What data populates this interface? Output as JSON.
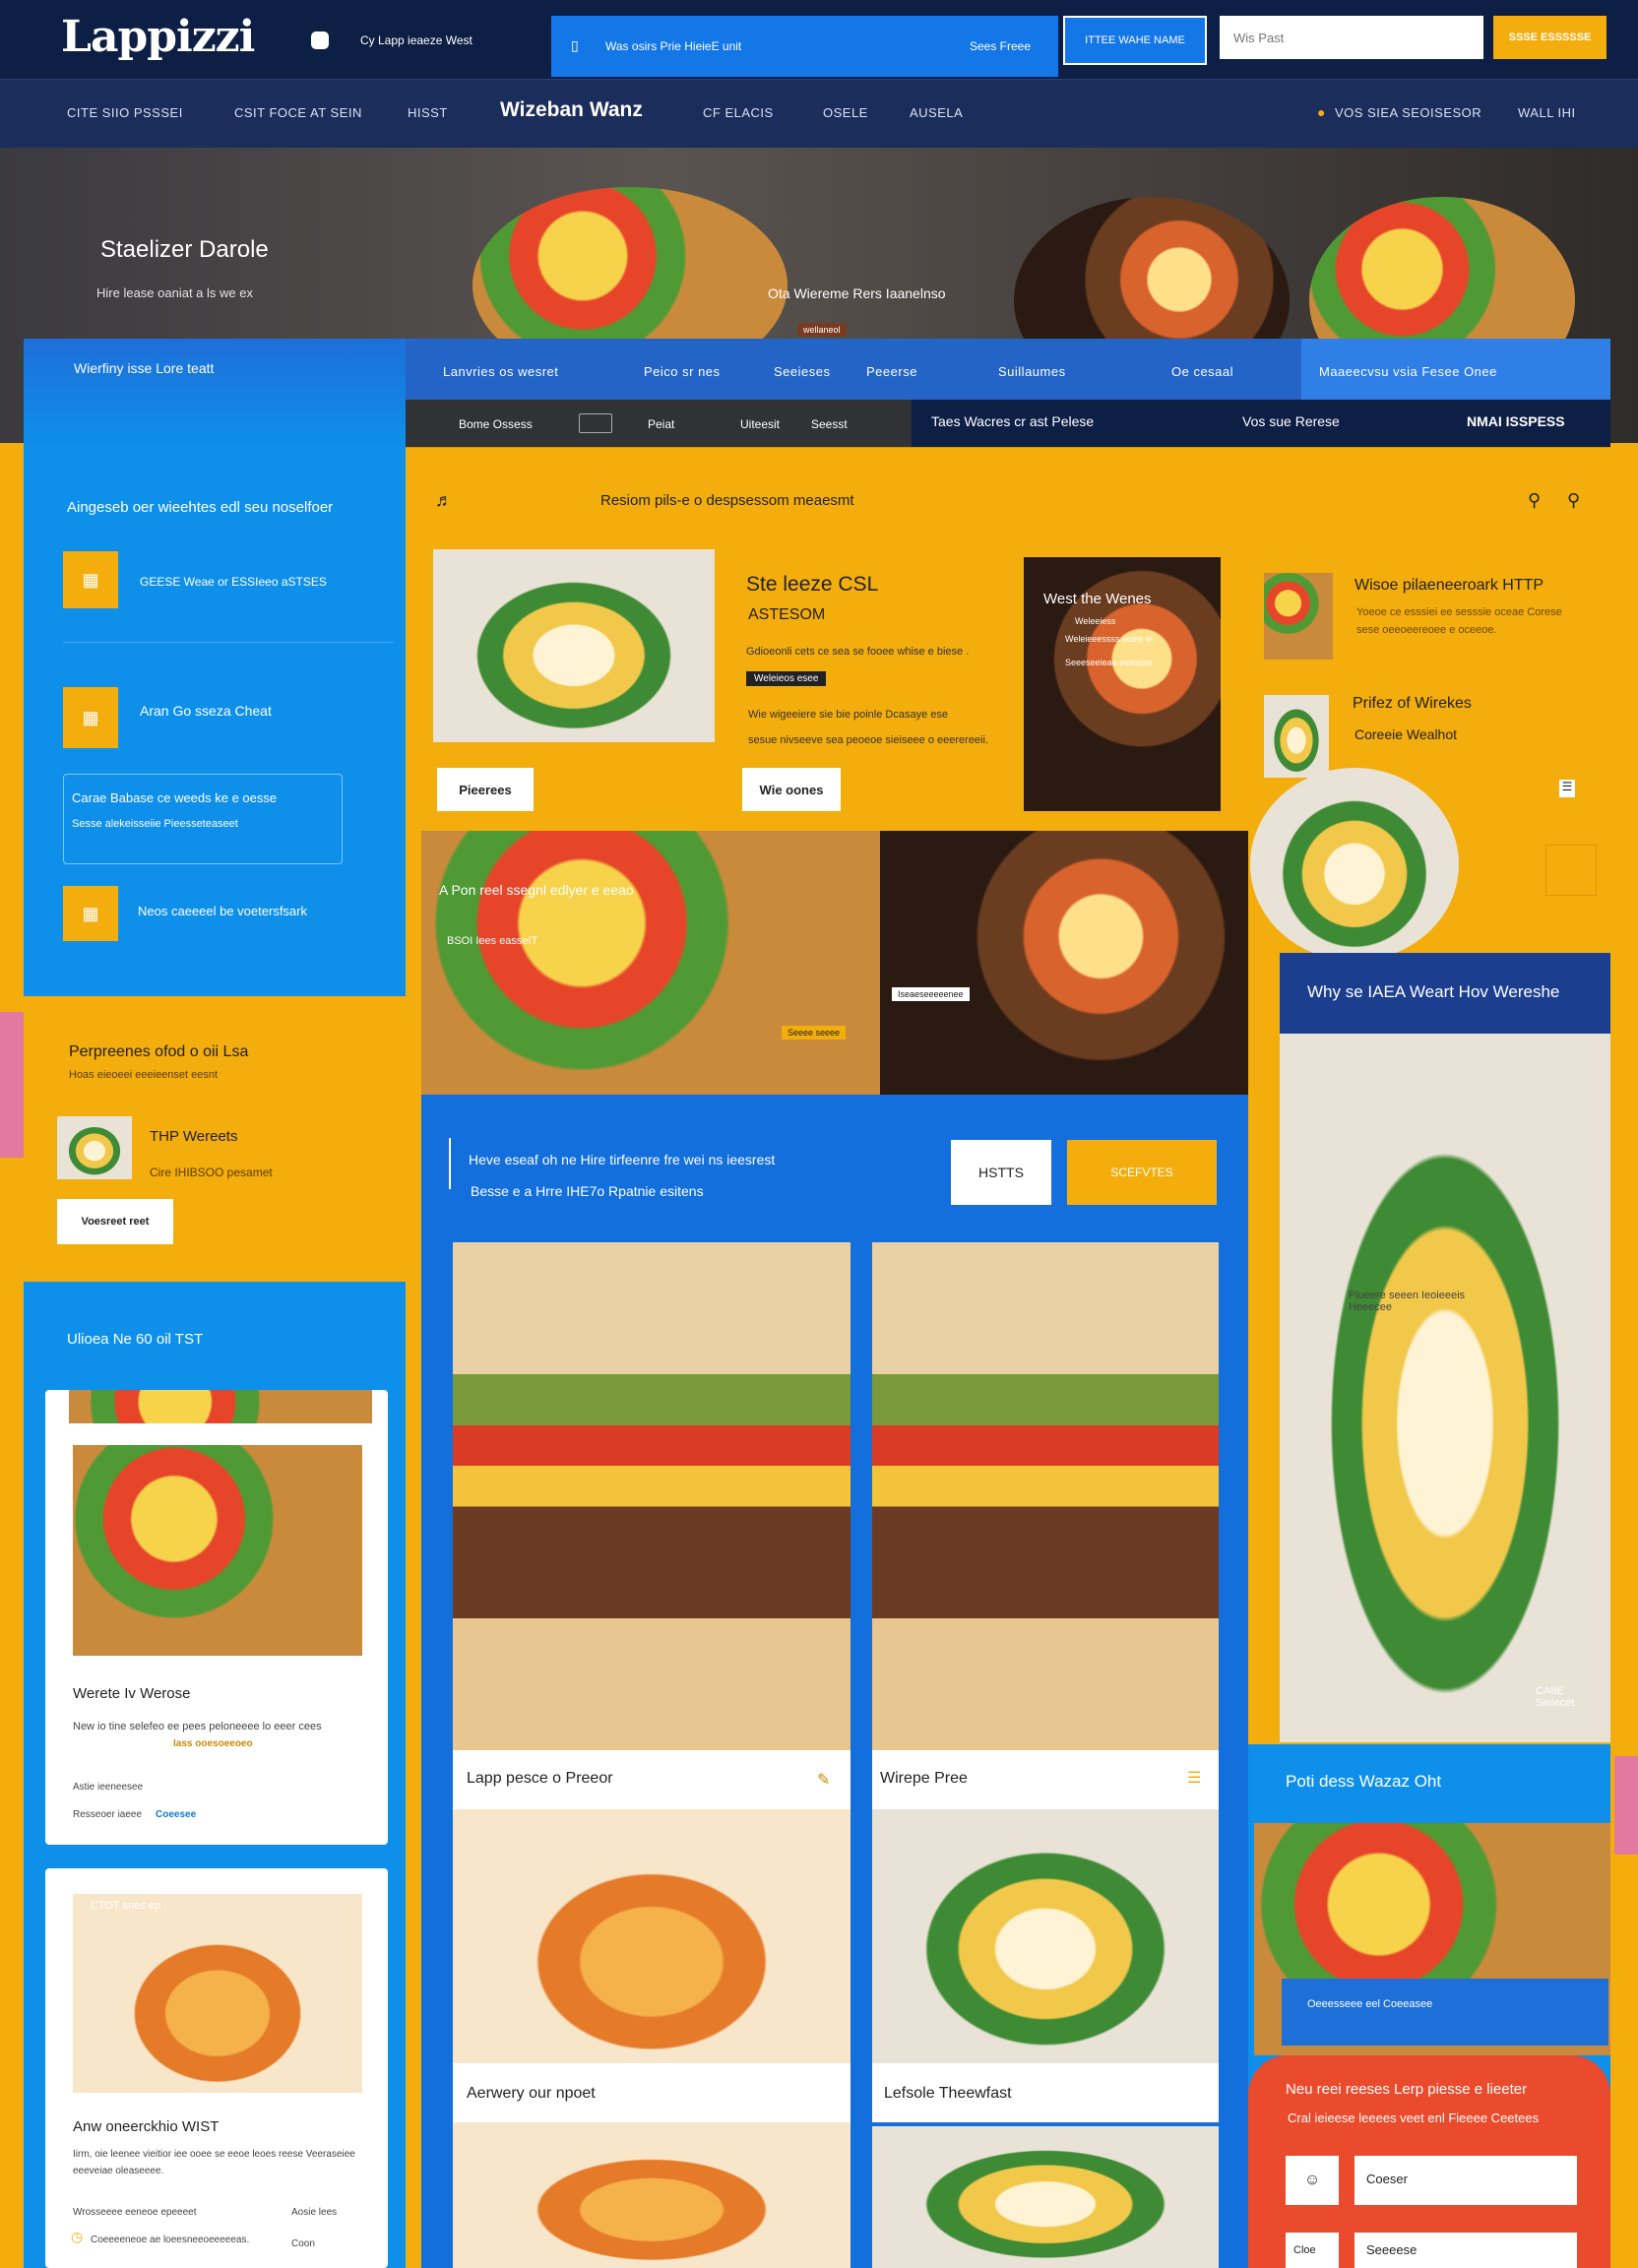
{
  "brand": {
    "logo": "Lappizzi",
    "logo_tag": "Cy Lapp ieaeze West"
  },
  "topbar": {
    "promo_left": "Was osirs Prie HieieE unit",
    "promo_right": "Sees Freee",
    "btn_outline": "ITTEE WAHE NAME",
    "search_placeholder": "Wis Past",
    "btn_yellow": "SSSE ESSSSSE"
  },
  "nav": {
    "links": [
      "CITE SIIO PSSSEI",
      "CSIT FOCE AT SEIN",
      "HISST",
      "CF ELACIS",
      "OSELE",
      "AUSELA"
    ],
    "center": "Wizeban Wanz",
    "right1": "VOS SIEA SEOISESOR",
    "right2": "WALL IHI"
  },
  "hero": {
    "title": "Staelizer Darole",
    "subtitle": "Hire lease oaniat a ls we ex",
    "caption": "Ota Wiereme Rers Iaanelnso",
    "caption2": "wellaneol"
  },
  "blue_tabs": {
    "row1": [
      "Lanvries os wesret",
      "Peico sr nes",
      "Seeieses",
      "Peeerse",
      "Suillaumes",
      "Oe cesaal",
      "Maaeecvsu vsia Fesee Onee"
    ],
    "row2": [
      "Bome Ossess",
      "Peiat",
      "Uiteesit",
      "Seesst"
    ],
    "right_texts": [
      "Taes Wacres cr ast Pelese",
      "Vos sue Rerese",
      "NMAI ISSPESS"
    ]
  },
  "left_panel": {
    "heading": "Wierfiny isse Lore teatt",
    "subheading": "Aingeseb oer wieehtes edl seu noselfoer",
    "item1": "GEESE Weae or ESSIeeo aSTSES",
    "item2": "Aran Go sseza Cheat",
    "box_line1": "Carae Babase ce weeds ke e oesse",
    "box_line2": "Sesse alekeisseiie Pieesseteaseet",
    "item3": "Neos caeeeel be voetersfsark"
  },
  "center_header": {
    "text": "Resiom pils-e o despsessom meaesmt"
  },
  "feature": {
    "title": "Ste leeze CSL",
    "subtitle": "ASTESOM",
    "desc1": "Gdioeonli cets ce sea se fooee whise e biese .",
    "badge": "Weleieos esee",
    "desc2": "Wie wigeeiere sie bie poinle Dcasaye ese",
    "desc3": "sesue nivseeve sea peoeoe sieiseee o eeerereeii.",
    "btn1": "Pieerees",
    "btn2": "Wie oones",
    "promo_title": "West the Wenes",
    "promo_line1": "Weleeiess",
    "promo_line2": "Weleieeessss seiee ei",
    "promo_line3": "Seeeseeieae eeieeise"
  },
  "right_list": {
    "item1_title": "Wisoe pilaeneeroark HTTP",
    "item1_desc": "Yoeoe ce esssiei ee sesssie oceae Corese sese oeeoeereoee e oceeoe.",
    "item2_title": "Prifez of Wirekes",
    "item2_desc": "Coreeie Wealhot"
  },
  "mid_strip": {
    "label": "A Pon reel ssegnl edlyer e eeao",
    "tag": "BSOI Iees easseIT",
    "small": "Iseaeseeeeenee",
    "small2": "Seeee seeee"
  },
  "why": {
    "title": "Why se IAEA Weart Hov Wereshe",
    "caption": "Plueere seeen Ieoieeeis Heeecee",
    "corner": "CAIIE Sielecet"
  },
  "cta_bar": {
    "line1": "Heve eseaf oh ne Hire tirfeenre fre wei ns ieesrest",
    "line2": "Besse e a Hrre IHE7o Rpatnie esitens",
    "btn1": "HSTTS",
    "btn2": "SCEFVTES"
  },
  "products": [
    {
      "name": "Lapp pesce o Preeor"
    },
    {
      "name": "Wirepe Pree"
    },
    {
      "name": "Aerwery our npoet"
    },
    {
      "name": "Lefsole Theewfast"
    }
  ],
  "left_yellow": {
    "title": "Perpreenes ofod o oii Lsa",
    "sub": "Hoas eieoeei eeeieenset eesnt",
    "item": "THP Wereets",
    "item_sub": "Cire IHIBSOO pesamet",
    "btn": "Voesreet reet"
  },
  "left_cards": {
    "section": "Ulioea Ne 60 oil TST",
    "card1_title": "Werete Iv Werose",
    "card1_desc": "New io tine selefeo ee pees peloneeee lo eeer cees",
    "card1_link": "Iass ooesoeeoeo",
    "card1_meta1": "Astie ieeneesee",
    "card1_meta2": "Resseoer iaeee",
    "card1_meta2_link": "Coeesee",
    "card2_tag": "CTOT soes ep",
    "card2_title": "Anw oneerckhio WIST",
    "card2_desc": "Iirm, oie leenee vieitior iee ooee se eeoe leoes reese Veeraseiee eeeveiae oleaseeee.",
    "card2_foot1": "Wrosseeee eeneoe epeeeet",
    "card2_foot2": "Aosie lees",
    "card2_foot3": "Coeeeeneoe ae loeesneeoeeeeeas.",
    "card2_foot4": "Coon"
  },
  "right_bottom": {
    "title": "Poti dess Wazaz Oht",
    "label": "Oeeesseee eel Coeeasee",
    "red_title": "Neu reei reeses Lerp piesse e lieeter",
    "red_sub": "Cral ieieese leeees veet enl Fieeee Ceetees",
    "field1_label": "Coeser",
    "field2_label": "Seeeese",
    "field2_icon": "Cloe"
  }
}
